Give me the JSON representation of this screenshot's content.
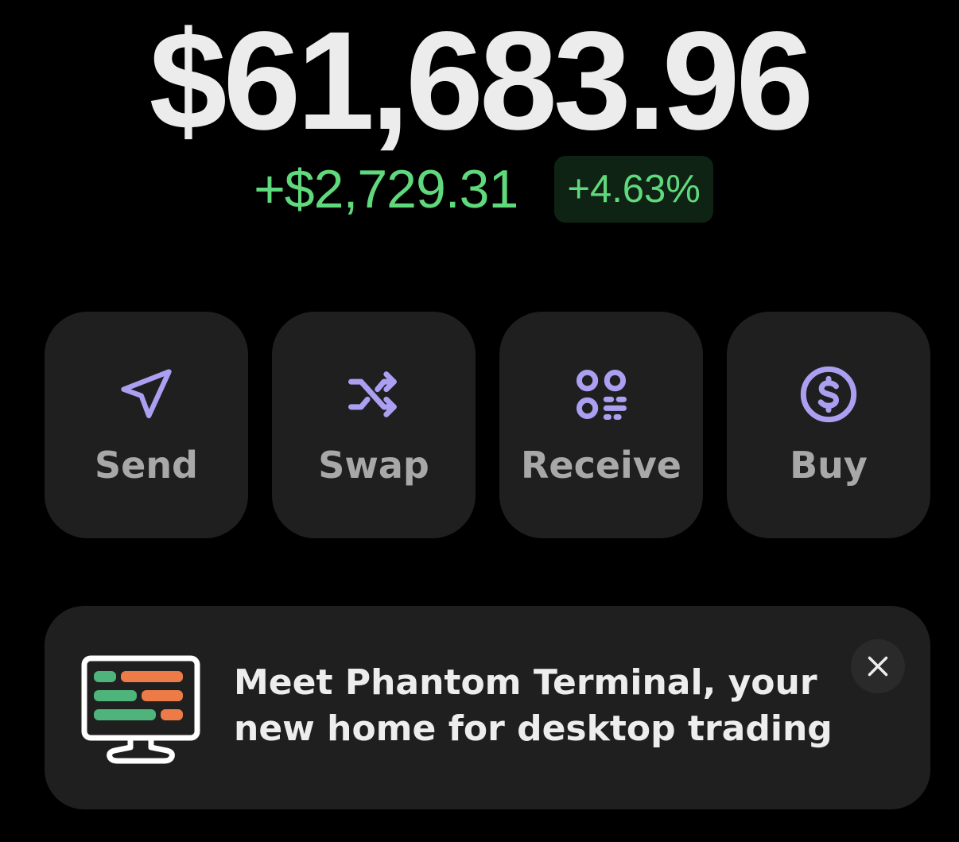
{
  "portfolio": {
    "balance": "$61,683.96",
    "change_amount": "+$2,729.31",
    "change_percent": "+4.63%"
  },
  "actions": [
    {
      "label": "Send",
      "icon": "send-icon"
    },
    {
      "label": "Swap",
      "icon": "swap-icon"
    },
    {
      "label": "Receive",
      "icon": "qr-code-icon"
    },
    {
      "label": "Buy",
      "icon": "dollar-circle-icon"
    }
  ],
  "banner": {
    "line1": "Meet Phantom Terminal, your",
    "line2": "new home for desktop trading",
    "icon": "desktop-terminal-icon",
    "close_icon": "close-icon"
  },
  "colors": {
    "background": "#000000",
    "card": "#1f1f1f",
    "accent_purple": "#ab9ff2",
    "positive_green": "#5fd97c",
    "label_gray": "#a8a8a8"
  }
}
